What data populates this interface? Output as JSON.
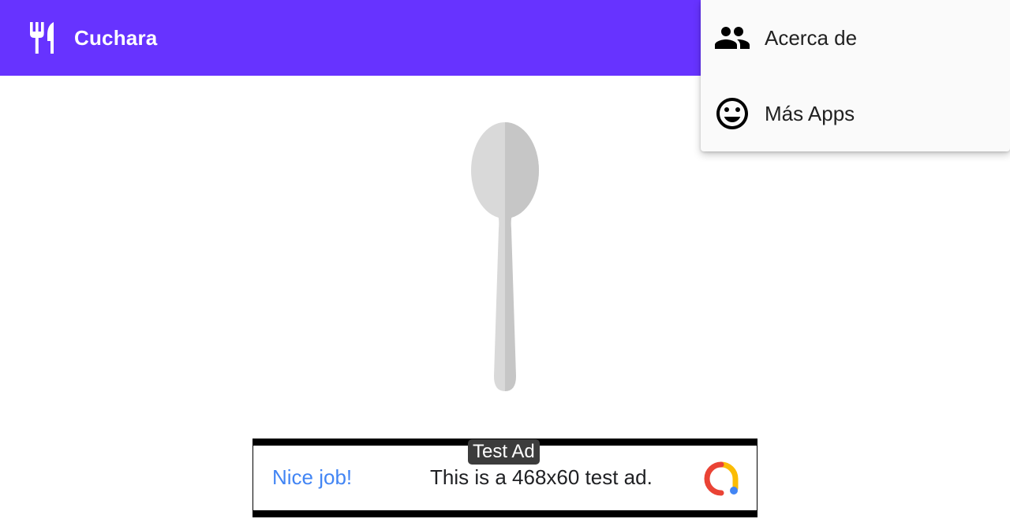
{
  "appbar": {
    "title": "Cuchara",
    "icon": "restaurant-icon",
    "color": "#6733ff"
  },
  "illustration": {
    "icon": "spoon-icon"
  },
  "menu": {
    "items": [
      {
        "label": "Acerca de",
        "icon": "people-icon"
      },
      {
        "label": "Más Apps",
        "icon": "smiley-icon"
      }
    ]
  },
  "ad": {
    "badge": "Test Ad",
    "cta": "Nice job!",
    "text": "This is a 468x60 test ad.",
    "cta_color": "#4285f4",
    "logo_icon": "admob-logo-icon"
  }
}
